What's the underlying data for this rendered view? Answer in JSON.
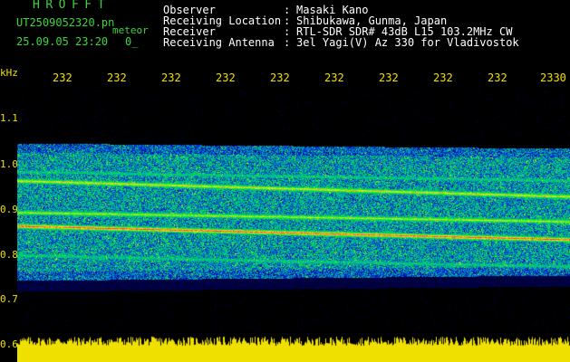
{
  "header": {
    "title": "HROFFT",
    "file_name": "UT2509052320.pn",
    "mode": "meteor",
    "datetime": "25.09.05 23:20",
    "flag": "0_",
    "info": [
      {
        "label": "Observer",
        "value": "Masaki Kano"
      },
      {
        "label": "Receiving Location",
        "value": "Shibukawa, Gunma, Japan"
      },
      {
        "label": "Receiver",
        "value": "RTL-SDR SDR# 43dB L15 103.2MHz CW"
      },
      {
        "label": "Receiving Antenna",
        "value": "3el Yagi(V) Az 330 for Vladivostok"
      }
    ]
  },
  "axis": {
    "unit": "kHz",
    "y_ticks": [
      "1.1",
      "1.0",
      "0.9",
      "0.8",
      "0.7",
      "0.6"
    ],
    "time_labels": [
      "232",
      "232",
      "232",
      "232",
      "232",
      "232",
      "232",
      "232",
      "232",
      "2330"
    ]
  },
  "colors": {
    "label_green": "#3cd53c",
    "label_yellow": "#f0e000",
    "background": "#000000",
    "spectrum_low": "#00107a",
    "spectrum_high": "#ff2060"
  },
  "spectrogram": {
    "freq_range_khz": [
      0.6,
      1.2
    ],
    "signal_lines": [
      {
        "start_khz": 0.965,
        "end_khz": 0.93,
        "strength": 0.75
      },
      {
        "start_khz": 0.895,
        "end_khz": 0.875,
        "strength": 0.7
      },
      {
        "start_khz": 0.865,
        "end_khz": 0.835,
        "strength": 0.9
      },
      {
        "start_khz": 0.985,
        "end_khz": 0.965,
        "strength": 0.45
      },
      {
        "start_khz": 0.8,
        "end_khz": 0.775,
        "strength": 0.45
      }
    ]
  }
}
